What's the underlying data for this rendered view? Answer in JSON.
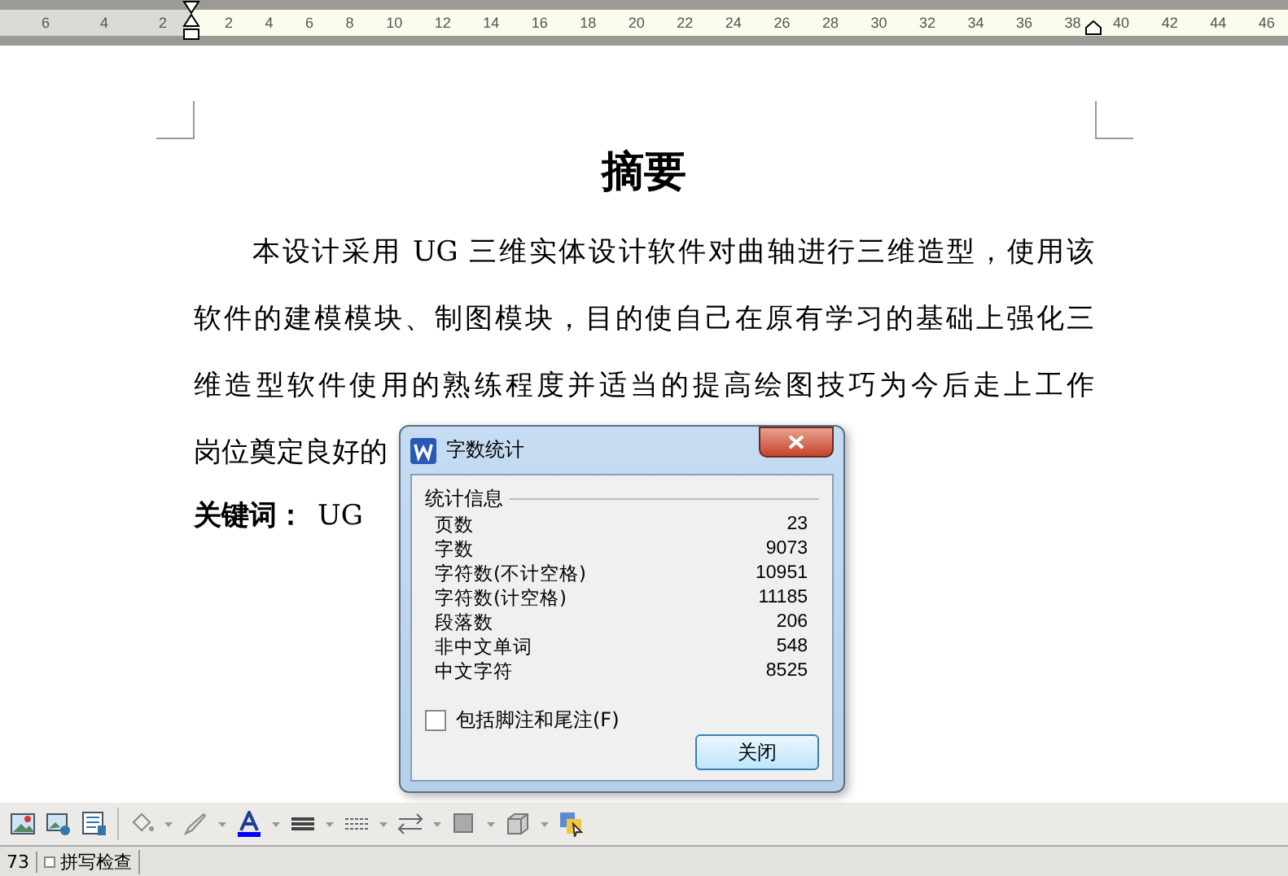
{
  "ruler": {
    "left_ticks": [
      "6",
      "4",
      "2"
    ],
    "right_ticks": [
      "2",
      "4",
      "6",
      "8",
      "10",
      "12",
      "14",
      "16",
      "18",
      "20",
      "22",
      "24",
      "26",
      "28",
      "30",
      "32",
      "34",
      "36",
      "38",
      "40",
      "42",
      "44",
      "46"
    ]
  },
  "document": {
    "title": "摘要",
    "paragraph_lines": [
      "本设计采用 UG 三维实体设计软件对曲轴进行三维造型，使用该",
      "软件的建模模块、制图模块，目的使自己在原有学习的基础上强化三",
      "维造型软件使用的熟练程度并适当的提高绘图技巧为今后走上工作",
      "岗位奠定良好的"
    ],
    "keywords_label": "关键词：",
    "keywords": "UG"
  },
  "dialog": {
    "title": "字数统计",
    "group": "统计信息",
    "stats": [
      {
        "label": "页数",
        "value": "23"
      },
      {
        "label": "字数",
        "value": "9073"
      },
      {
        "label": "字符数(不计空格)",
        "value": "10951"
      },
      {
        "label": "字符数(计空格)",
        "value": "11185"
      },
      {
        "label": "段落数",
        "value": "206"
      },
      {
        "label": "非中文单词",
        "value": "548"
      },
      {
        "label": "中文字符",
        "value": "8525"
      }
    ],
    "checkbox": {
      "label": "包括脚注和尾注(F)",
      "checked": false
    },
    "button": "关闭"
  },
  "status_bar": {
    "page_count": "73",
    "spell_check": "拼写检查"
  }
}
